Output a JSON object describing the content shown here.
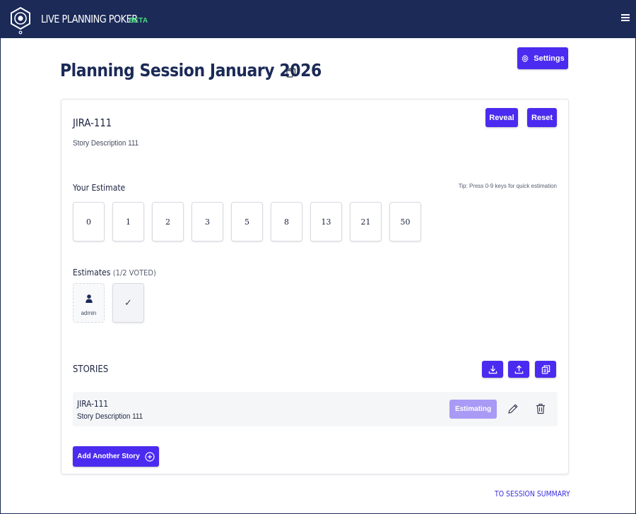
{
  "header": {
    "brand": "LIVE PLANNING POKER",
    "badge": "BETA"
  },
  "page": {
    "title": "Planning Session January 2026",
    "settings_label": "Settings"
  },
  "current_story": {
    "key": "JIRA-111",
    "description": "Story Description 111",
    "reveal_label": "Reveal",
    "reset_label": "Reset"
  },
  "estimate": {
    "label": "Your Estimate",
    "tip": "Tip: Press 0-9 keys for quick estimation",
    "cards": [
      "0",
      "1",
      "2",
      "3",
      "5",
      "8",
      "13",
      "21",
      "50"
    ]
  },
  "estimates": {
    "label": "Estimates",
    "count": "(1/2 VOTED)",
    "voters": [
      {
        "name": "admin"
      }
    ],
    "checkmark": "✓"
  },
  "stories": {
    "title": "STORIES",
    "items": [
      {
        "key": "JIRA-111",
        "description": "Story Description 111",
        "status": "Estimating"
      }
    ],
    "add_label": "Add Another Story"
  },
  "footer": {
    "summary_link": "TO SESSION SUMMARY"
  },
  "colors": {
    "navy": "#1b2a57",
    "accent": "#4b2bf0",
    "beta": "#4ade80",
    "estimating": "#a99af5"
  }
}
